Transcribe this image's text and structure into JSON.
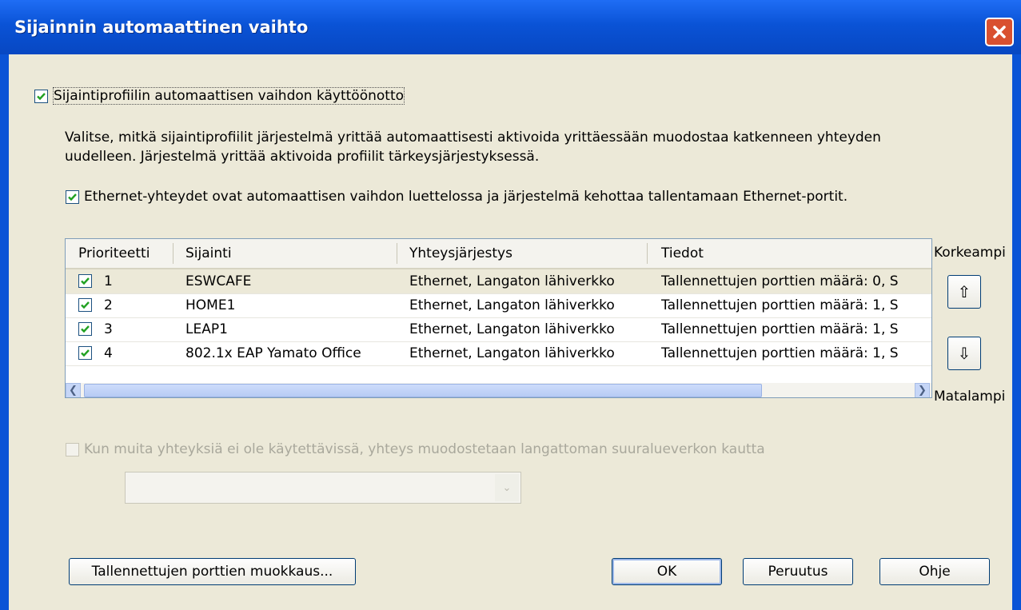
{
  "window": {
    "title": "Sijainnin automaattinen vaihto"
  },
  "enable_checkbox": {
    "label": "Sijaintiprofiilin automaattisen vaihdon käyttöönotto",
    "checked": true
  },
  "description": {
    "line1": "Valitse, mitkä sijaintiprofiilit järjestelmä yrittää automaattisesti aktivoida yrittäessään muodostaa katkenneen yhteyden",
    "line2": "uudelleen. Järjestelmä yrittää aktivoida profiilit tärkeysjärjestyksessä."
  },
  "ethernet_checkbox": {
    "label": "Ethernet-yhteydet ovat automaattisen vaihdon luettelossa ja järjestelmä kehottaa tallentamaan Ethernet-portit.",
    "checked": true
  },
  "table": {
    "columns": [
      "Prioriteetti",
      "Sijainti",
      "Yhteysjärjestys",
      "Tiedot"
    ],
    "rows": [
      {
        "checked": true,
        "priority": "1",
        "location": "ESWCAFE",
        "order": "Ethernet, Langaton lähiverkko",
        "info": "Tallennettujen porttien määrä: 0, S"
      },
      {
        "checked": true,
        "priority": "2",
        "location": "HOME1",
        "order": "Ethernet, Langaton lähiverkko",
        "info": "Tallennettujen porttien määrä: 1, S"
      },
      {
        "checked": true,
        "priority": "3",
        "location": "LEAP1",
        "order": "Ethernet, Langaton lähiverkko",
        "info": "Tallennettujen porttien määrä: 1, S"
      },
      {
        "checked": true,
        "priority": "4",
        "location": "802.1x EAP Yamato Office",
        "order": "Ethernet, Langaton lähiverkko",
        "info": "Tallennettujen porttien määrä: 1, S"
      }
    ]
  },
  "priority_controls": {
    "higher_label": "Korkeampi",
    "lower_label": "Matalampi"
  },
  "wwan_checkbox": {
    "label": "Kun muita yhteyksiä ei ole käytettävissä, yhteys muodostetaan langattoman suuralueverkon kautta",
    "checked": false,
    "disabled": true
  },
  "wwan_combo": {
    "value": "",
    "disabled": true
  },
  "buttons": {
    "edit_ports": "Tallennettujen porttien muokkaus...",
    "ok": "OK",
    "cancel": "Peruutus",
    "help": "Ohje"
  },
  "colors": {
    "titlebar": "#0a53d6",
    "dialog_bg": "#ece9d8",
    "check_green": "#21a121",
    "close_red": "#d9502f"
  }
}
